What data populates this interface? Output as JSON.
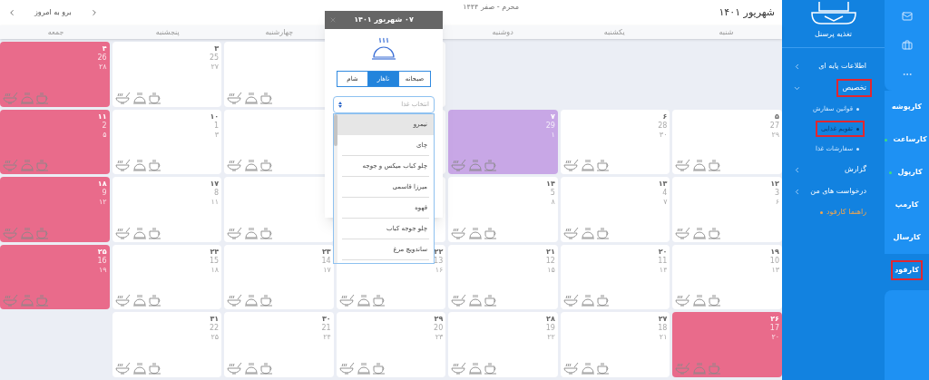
{
  "header": {
    "title": "شهریور ۱۴۰۱",
    "hijri_range": "محرم - صفر ۱۴۴۴",
    "today_button": "برو به امروز"
  },
  "weekdays": [
    {
      "kind": "label",
      "label": "شنبه"
    },
    {
      "kind": "label",
      "label": "یکشنبه"
    },
    {
      "kind": "label",
      "label": "دوشنبه"
    },
    {
      "kind": "covered"
    },
    {
      "kind": "label",
      "label": "چهارشنبه"
    },
    {
      "kind": "label",
      "label": "پنجشنبه"
    },
    {
      "kind": "label",
      "label": "جمعه"
    }
  ],
  "weeks": [
    [
      {
        "kind": "empty"
      },
      {
        "kind": "empty"
      },
      {
        "kind": "empty"
      },
      {
        "kind": "blank"
      },
      {
        "kind": "day",
        "color": "#ffffff"
      },
      {
        "kind": "day",
        "color": "#ffffff",
        "day": "۳",
        "gregorian": "25",
        "hijri": "۲۷"
      },
      {
        "kind": "day",
        "color": "#e96b8b",
        "day": "۴",
        "gregorian": "26",
        "hijri": "۲۸"
      }
    ],
    [
      {
        "kind": "day",
        "color": "#ffffff",
        "day": "۵",
        "gregorian": "27",
        "hijri": "۲۹"
      },
      {
        "kind": "day",
        "color": "#ffffff",
        "day": "۶",
        "gregorian": "28",
        "hijri": "۳۰"
      },
      {
        "kind": "day",
        "color": "#c8a7e6",
        "day": "۷",
        "gregorian": "29",
        "hijri": "۱"
      },
      {
        "kind": "blank"
      },
      {
        "kind": "day",
        "color": "#ffffff"
      },
      {
        "kind": "day",
        "color": "#ffffff",
        "day": "۱۰",
        "gregorian": "1",
        "hijri": "۳"
      },
      {
        "kind": "day",
        "color": "#e96b8b",
        "day": "۱۱",
        "gregorian": "2",
        "hijri": "۵"
      }
    ],
    [
      {
        "kind": "day",
        "color": "#ffffff",
        "day": "۱۲",
        "gregorian": "3",
        "hijri": "۶"
      },
      {
        "kind": "day",
        "color": "#ffffff",
        "day": "۱۳",
        "gregorian": "4",
        "hijri": "۷"
      },
      {
        "kind": "day",
        "color": "#ffffff",
        "day": "۱۴",
        "gregorian": "5",
        "hijri": "۸"
      },
      {
        "kind": "blank"
      },
      {
        "kind": "day",
        "color": "#ffffff"
      },
      {
        "kind": "day",
        "color": "#ffffff",
        "day": "۱۷",
        "gregorian": "8",
        "hijri": "۱۱"
      },
      {
        "kind": "day",
        "color": "#e96b8b",
        "day": "۱۸",
        "gregorian": "9",
        "hijri": "۱۲"
      }
    ],
    [
      {
        "kind": "day",
        "color": "#ffffff",
        "day": "۱۹",
        "gregorian": "10",
        "hijri": "۱۳"
      },
      {
        "kind": "day",
        "color": "#ffffff",
        "day": "۲۰",
        "gregorian": "11",
        "hijri": "۱۴"
      },
      {
        "kind": "day",
        "color": "#ffffff",
        "day": "۲۱",
        "gregorian": "12",
        "hijri": "۱۵"
      },
      {
        "kind": "day",
        "color": "#ffffff",
        "day": "۲۲",
        "gregorian": "13",
        "hijri": "۱۶"
      },
      {
        "kind": "day",
        "color": "#ffffff",
        "day": "۲۳",
        "gregorian": "14",
        "hijri": "۱۷"
      },
      {
        "kind": "day",
        "color": "#ffffff",
        "day": "۲۴",
        "gregorian": "15",
        "hijri": "۱۸"
      },
      {
        "kind": "day",
        "color": "#e96b8b",
        "day": "۲۵",
        "gregorian": "16",
        "hijri": "۱۹"
      }
    ],
    [
      {
        "kind": "day",
        "color": "#e96b8b",
        "day": "۲۶",
        "gregorian": "17",
        "hijri": "۲۰"
      },
      {
        "kind": "day",
        "color": "#ffffff",
        "day": "۲۷",
        "gregorian": "18",
        "hijri": "۲۱"
      },
      {
        "kind": "day",
        "color": "#ffffff",
        "day": "۲۸",
        "gregorian": "19",
        "hijri": "۲۲"
      },
      {
        "kind": "day",
        "color": "#ffffff",
        "day": "۲۹",
        "gregorian": "20",
        "hijri": "۲۳"
      },
      {
        "kind": "day",
        "color": "#ffffff",
        "day": "۳۰",
        "gregorian": "21",
        "hijri": "۲۴"
      },
      {
        "kind": "day",
        "color": "#ffffff",
        "day": "۳۱",
        "gregorian": "22",
        "hijri": "۲۵"
      },
      {
        "kind": "empty"
      }
    ]
  ],
  "popup": {
    "title": "۰۷ شهریور ۱۴۰۱",
    "tabs": [
      {
        "label": "صبحانه",
        "selected": false
      },
      {
        "label": "ناهار",
        "selected": true
      },
      {
        "label": "شام",
        "selected": false
      }
    ],
    "select": {
      "placeholder": "انتخاب غذا"
    },
    "options": [
      {
        "label": "نیمرو",
        "highlighted": true
      },
      {
        "label": "چای",
        "highlighted": false
      },
      {
        "label": "چلو کباب میکس و جوجه",
        "highlighted": false
      },
      {
        "label": "میرزا قاسمی",
        "highlighted": false
      },
      {
        "label": "قهوه",
        "highlighted": false
      },
      {
        "label": "چلو جوجه کباب",
        "highlighted": false
      },
      {
        "label": "ساندویچ مرغ",
        "highlighted": false
      }
    ]
  },
  "sidebar": {
    "brand": "تغذیه پرسنل",
    "apps": [
      {
        "label": "کارپوشه",
        "dot": false,
        "selected": false,
        "highlighted": false
      },
      {
        "label": "کارساعت",
        "dot": true,
        "selected": false,
        "highlighted": false
      },
      {
        "label": "کارپول",
        "dot": true,
        "selected": false,
        "highlighted": false
      },
      {
        "label": "کارمپ",
        "dot": false,
        "selected": false,
        "highlighted": false
      },
      {
        "label": "کارسال",
        "dot": false,
        "selected": false,
        "highlighted": false
      },
      {
        "label": "کارفود",
        "dot": false,
        "selected": true,
        "highlighted": true
      }
    ],
    "menu": [
      {
        "kind": "group",
        "label": "اطلاعات پایه ای",
        "expanded": false,
        "highlighted": false
      },
      {
        "kind": "group",
        "label": "تخصیص",
        "expanded": true,
        "highlighted": true,
        "children": [
          {
            "label": "قوانین سفارش",
            "selected": false,
            "highlighted": false
          },
          {
            "label": "تقویم غذایی",
            "selected": true,
            "highlighted": true
          },
          {
            "label": "سفارشات غذا",
            "selected": false,
            "highlighted": false
          }
        ]
      },
      {
        "kind": "group",
        "label": "گزارش",
        "expanded": false,
        "highlighted": false
      },
      {
        "kind": "group",
        "label": "درخواست های من",
        "expanded": false,
        "highlighted": false
      },
      {
        "kind": "link",
        "label": "راهنما کارفود"
      }
    ]
  }
}
